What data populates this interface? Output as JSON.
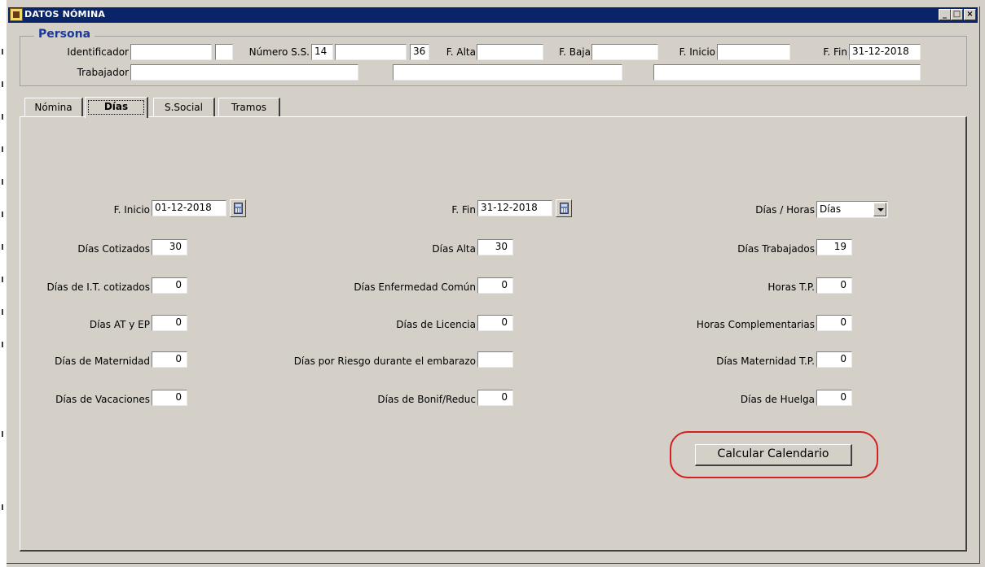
{
  "window": {
    "title": "DATOS NÓMINA"
  },
  "titlebar": {
    "min": "_",
    "max": "□",
    "close": "×"
  },
  "persona": {
    "group_title": "Persona",
    "identificador_label": "Identificador",
    "identificador_value": "",
    "identificador_value2": "",
    "numero_ss_label": "Número S.S.",
    "numero_ss_value1": "14",
    "numero_ss_value2": "",
    "numero_ss_value3": "36",
    "f_alta_label": "F. Alta",
    "f_alta_value": "",
    "f_baja_label": "F. Baja",
    "f_baja_value": "",
    "f_inicio_label": "F. Inicio",
    "f_inicio_value": "",
    "f_fin_label": "F. Fin",
    "f_fin_value": "31-12-2018",
    "trabajador_label": "Trabajador",
    "trabajador_value1": "",
    "trabajador_value2": "",
    "trabajador_value3": ""
  },
  "tabs": [
    {
      "label": "Nómina"
    },
    {
      "label": "Días"
    },
    {
      "label": "S.Social"
    },
    {
      "label": "Tramos"
    }
  ],
  "dias": {
    "f_inicio_label": "F. Inicio",
    "f_inicio_value": "01-12-2018",
    "f_fin_label": "F. Fin",
    "f_fin_value": "31-12-2018",
    "dias_horas_label": "Días / Horas",
    "dias_horas_value": "Días",
    "cotizados_label": "Días Cotizados",
    "cotizados_value": "30",
    "alta_label": "Días Alta",
    "alta_value": "30",
    "trabajados_label": "Días Trabajados",
    "trabajados_value": "19",
    "it_cotizados_label": "Días de I.T. cotizados",
    "it_cotizados_value": "0",
    "enfermedad_label": "Días Enfermedad Común",
    "enfermedad_value": "0",
    "horas_tp_label": "Horas T.P.",
    "horas_tp_value": "0",
    "at_ep_label": "Días AT y EP",
    "at_ep_value": "0",
    "licencia_label": "Días de Licencia",
    "licencia_value": "0",
    "horas_compl_label": "Horas Complementarias",
    "horas_compl_value": "0",
    "maternidad_label": "Días de Maternidad",
    "maternidad_value": "0",
    "riesgo_label": "Días por Riesgo durante el embarazo",
    "riesgo_value": "",
    "maternidad_tp_label": "Días Maternidad T.P.",
    "maternidad_tp_value": "0",
    "vacaciones_label": "Días de Vacaciones",
    "vacaciones_value": "0",
    "bonif_label": "Días de Bonif/Reduc",
    "bonif_value": "0",
    "huelga_label": "Días de Huelga",
    "huelga_value": "0",
    "calcular_label": "Calcular Calendario"
  },
  "icons": {
    "app": "app-icon",
    "calendar": "calendar-icon",
    "dropdown": "chevron-down-icon"
  },
  "colors": {
    "titlebar": "#0a246a",
    "group_title": "#1a3a9a",
    "highlight_ring": "#d42020",
    "window_bg": "#d4d0c8"
  }
}
